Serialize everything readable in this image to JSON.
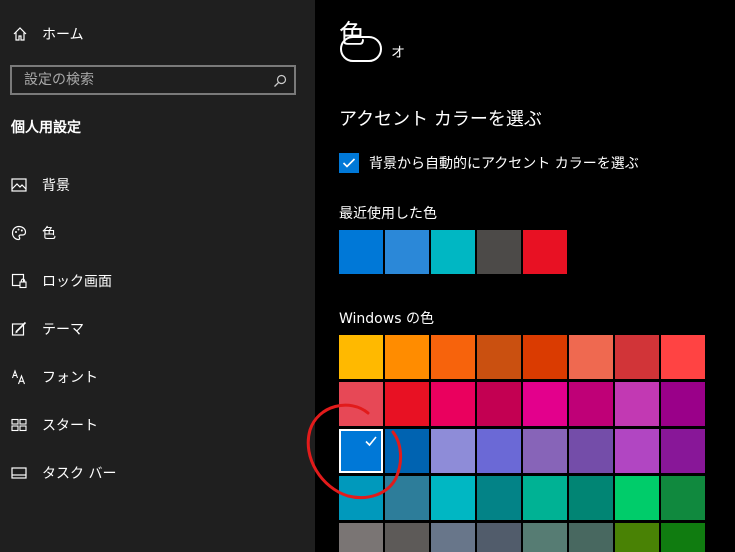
{
  "sidebar": {
    "home_label": "ホーム",
    "search_placeholder": "設定の検索",
    "section_title": "個人用設定",
    "items": [
      {
        "label": "背景",
        "icon": "picture-icon"
      },
      {
        "label": "色",
        "icon": "palette-icon"
      },
      {
        "label": "ロック画面",
        "icon": "lock-screen-icon"
      },
      {
        "label": "テーマ",
        "icon": "theme-icon"
      },
      {
        "label": "フォント",
        "icon": "font-icon"
      },
      {
        "label": "スタート",
        "icon": "start-icon"
      },
      {
        "label": "タスク バー",
        "icon": "taskbar-icon"
      }
    ]
  },
  "main": {
    "title": "色",
    "toggle_text": "オ",
    "accent_heading": "アクセント カラーを選ぶ",
    "auto_accent_label": "背景から自動的にアクセント カラーを選ぶ",
    "auto_accent_checked": true,
    "recent_label": "最近使用した色",
    "recent_colors": [
      "#0078d7",
      "#2b88d8",
      "#00b7c3",
      "#4c4a48",
      "#e81123"
    ],
    "windows_label": "Windows の色",
    "windows_colors": [
      [
        "#ffb900",
        "#ff8c00",
        "#f7630c",
        "#ca5010",
        "#da3b01",
        "#ef6950",
        "#d13438",
        "#ff4343"
      ],
      [
        "#e74856",
        "#e81123",
        "#ea005e",
        "#c30052",
        "#e3008c",
        "#bf0077",
        "#c239b3",
        "#9a0089"
      ],
      [
        "#0078d7",
        "#0063b1",
        "#8e8cd8",
        "#6b69d6",
        "#8764b8",
        "#744da9",
        "#b146c2",
        "#881798"
      ],
      [
        "#0099bc",
        "#2d7d9a",
        "#00b7c3",
        "#038387",
        "#00b294",
        "#018574",
        "#00cc6a",
        "#10893e"
      ],
      [
        "#7a7574",
        "#5d5a58",
        "#68768a",
        "#515c6b",
        "#567c73",
        "#486860",
        "#498205",
        "#107c10"
      ]
    ],
    "selected_color": "#0078d7",
    "annotation_color": "#e21b1b"
  }
}
